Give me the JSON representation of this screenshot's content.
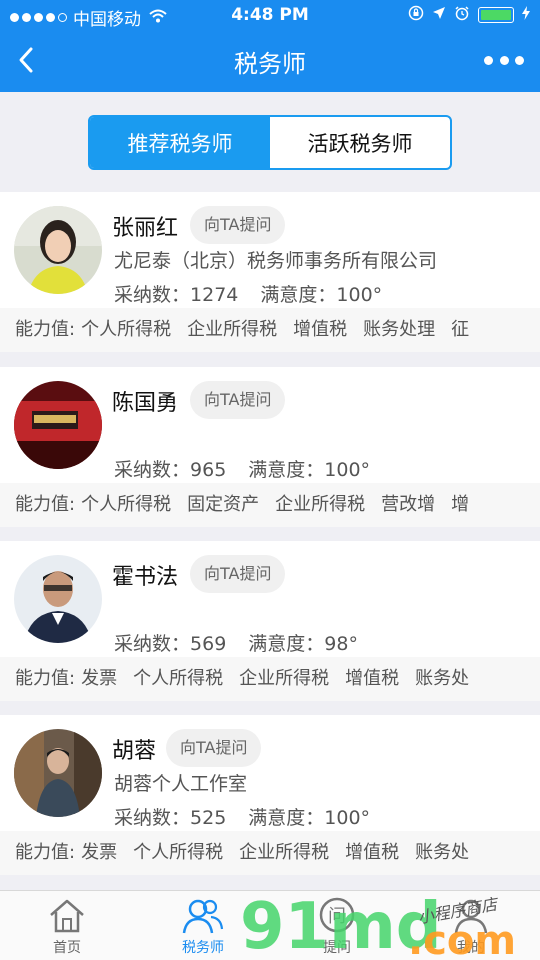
{
  "status": {
    "carrier": "中国移动",
    "time": "4:48 PM"
  },
  "nav": {
    "title": "税务师"
  },
  "tabs": [
    {
      "label": "推荐税务师",
      "active": true
    },
    {
      "label": "活跃税务师",
      "active": false
    }
  ],
  "advisors": [
    {
      "name": "张丽红",
      "ask": "向TA提问",
      "org": "尤尼泰（北京）税务师事务所有限公司",
      "adopt_label": "采纳数：",
      "adopt": "1274",
      "sat_label": "满意度：",
      "sat": "100°",
      "skills_label": "能力值:",
      "skills": [
        "个人所得税",
        "企业所得税",
        "增值税",
        "账务处理",
        "征"
      ]
    },
    {
      "name": "陈国勇",
      "ask": "向TA提问",
      "org": "",
      "adopt_label": "采纳数：",
      "adopt": "965",
      "sat_label": "满意度：",
      "sat": "100°",
      "skills_label": "能力值:",
      "skills": [
        "个人所得税",
        "固定资产",
        "企业所得税",
        "营改增",
        "增"
      ]
    },
    {
      "name": "霍书法",
      "ask": "向TA提问",
      "org": "",
      "adopt_label": "采纳数：",
      "adopt": "569",
      "sat_label": "满意度：",
      "sat": "98°",
      "skills_label": "能力值:",
      "skills": [
        "发票",
        "个人所得税",
        "企业所得税",
        "增值税",
        "账务处"
      ]
    },
    {
      "name": "胡蓉",
      "ask": "向TA提问",
      "org": "胡蓉个人工作室",
      "adopt_label": "采纳数：",
      "adopt": "525",
      "sat_label": "满意度：",
      "sat": "100°",
      "skills_label": "能力值:",
      "skills": [
        "发票",
        "个人所得税",
        "企业所得税",
        "增值税",
        "账务处"
      ]
    }
  ],
  "tabbar": [
    {
      "label": "首页",
      "icon": "home-icon",
      "active": false
    },
    {
      "label": "税务师",
      "icon": "people-icon",
      "active": true
    },
    {
      "label": "提问",
      "icon": "ask-icon",
      "active": false
    },
    {
      "label": "我的",
      "icon": "person-icon",
      "active": false
    }
  ],
  "watermark": {
    "text": "91md.com",
    "handwritten": "小程序商店"
  },
  "colors": {
    "brand": "#1a8cf0",
    "segment_active": "#1a9bf0"
  }
}
